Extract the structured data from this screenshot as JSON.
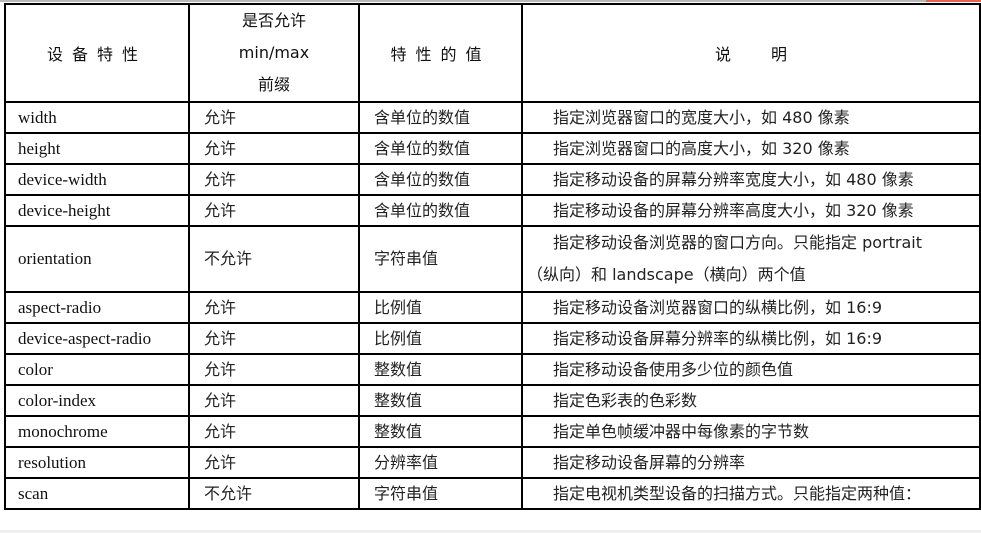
{
  "table": {
    "headers": {
      "feature": "设备特性",
      "prefix_line1": "是否允许",
      "prefix_line2": "min/max",
      "prefix_line3": "前缀",
      "value": "特性的值",
      "desc_part1": "说",
      "desc_part2": "明"
    },
    "rows": [
      {
        "feature": "width",
        "prefix": "允许",
        "value": "含单位的数值",
        "desc": "指定浏览器窗口的宽度大小，如 480 像素"
      },
      {
        "feature": "height",
        "prefix": "允许",
        "value": "含单位的数值",
        "desc": "指定浏览器窗口的高度大小，如 320 像素"
      },
      {
        "feature": "device-width",
        "prefix": "允许",
        "value": "含单位的数值",
        "desc": "指定移动设备的屏幕分辨率宽度大小，如 480 像素"
      },
      {
        "feature": "device-height",
        "prefix": "允许",
        "value": "含单位的数值",
        "desc": "指定移动设备的屏幕分辨率高度大小，如 320 像素"
      },
      {
        "feature": "orientation",
        "prefix": "不允许",
        "value": "字符串值",
        "desc_line1": "指定移动设备浏览器的窗口方向。只能指定 portrait",
        "desc_line2": "（纵向）和 landscape（横向）两个值"
      },
      {
        "feature": "aspect-radio",
        "prefix": "允许",
        "value": "比例值",
        "desc": "指定移动设备浏览器窗口的纵横比例，如 16:9"
      },
      {
        "feature": "device-aspect-radio",
        "prefix": "允许",
        "value": "比例值",
        "desc": "指定移动设备屏幕分辨率的纵横比例，如 16:9"
      },
      {
        "feature": "color",
        "prefix": "允许",
        "value": "整数值",
        "desc": "指定移动设备使用多少位的颜色值"
      },
      {
        "feature": "color-index",
        "prefix": "允许",
        "value": "整数值",
        "desc": "指定色彩表的色彩数"
      },
      {
        "feature": "monochrome",
        "prefix": "允许",
        "value": "整数值",
        "desc": "指定单色帧缓冲器中每像素的字节数"
      },
      {
        "feature": "resolution",
        "prefix": "允许",
        "value": "分辨率值",
        "desc": "指定移动设备屏幕的分辨率"
      },
      {
        "feature": "scan",
        "prefix": "不允许",
        "value": "字符串值",
        "desc": "指定电视机类型设备的扫描方式。只能指定两种值："
      }
    ]
  }
}
